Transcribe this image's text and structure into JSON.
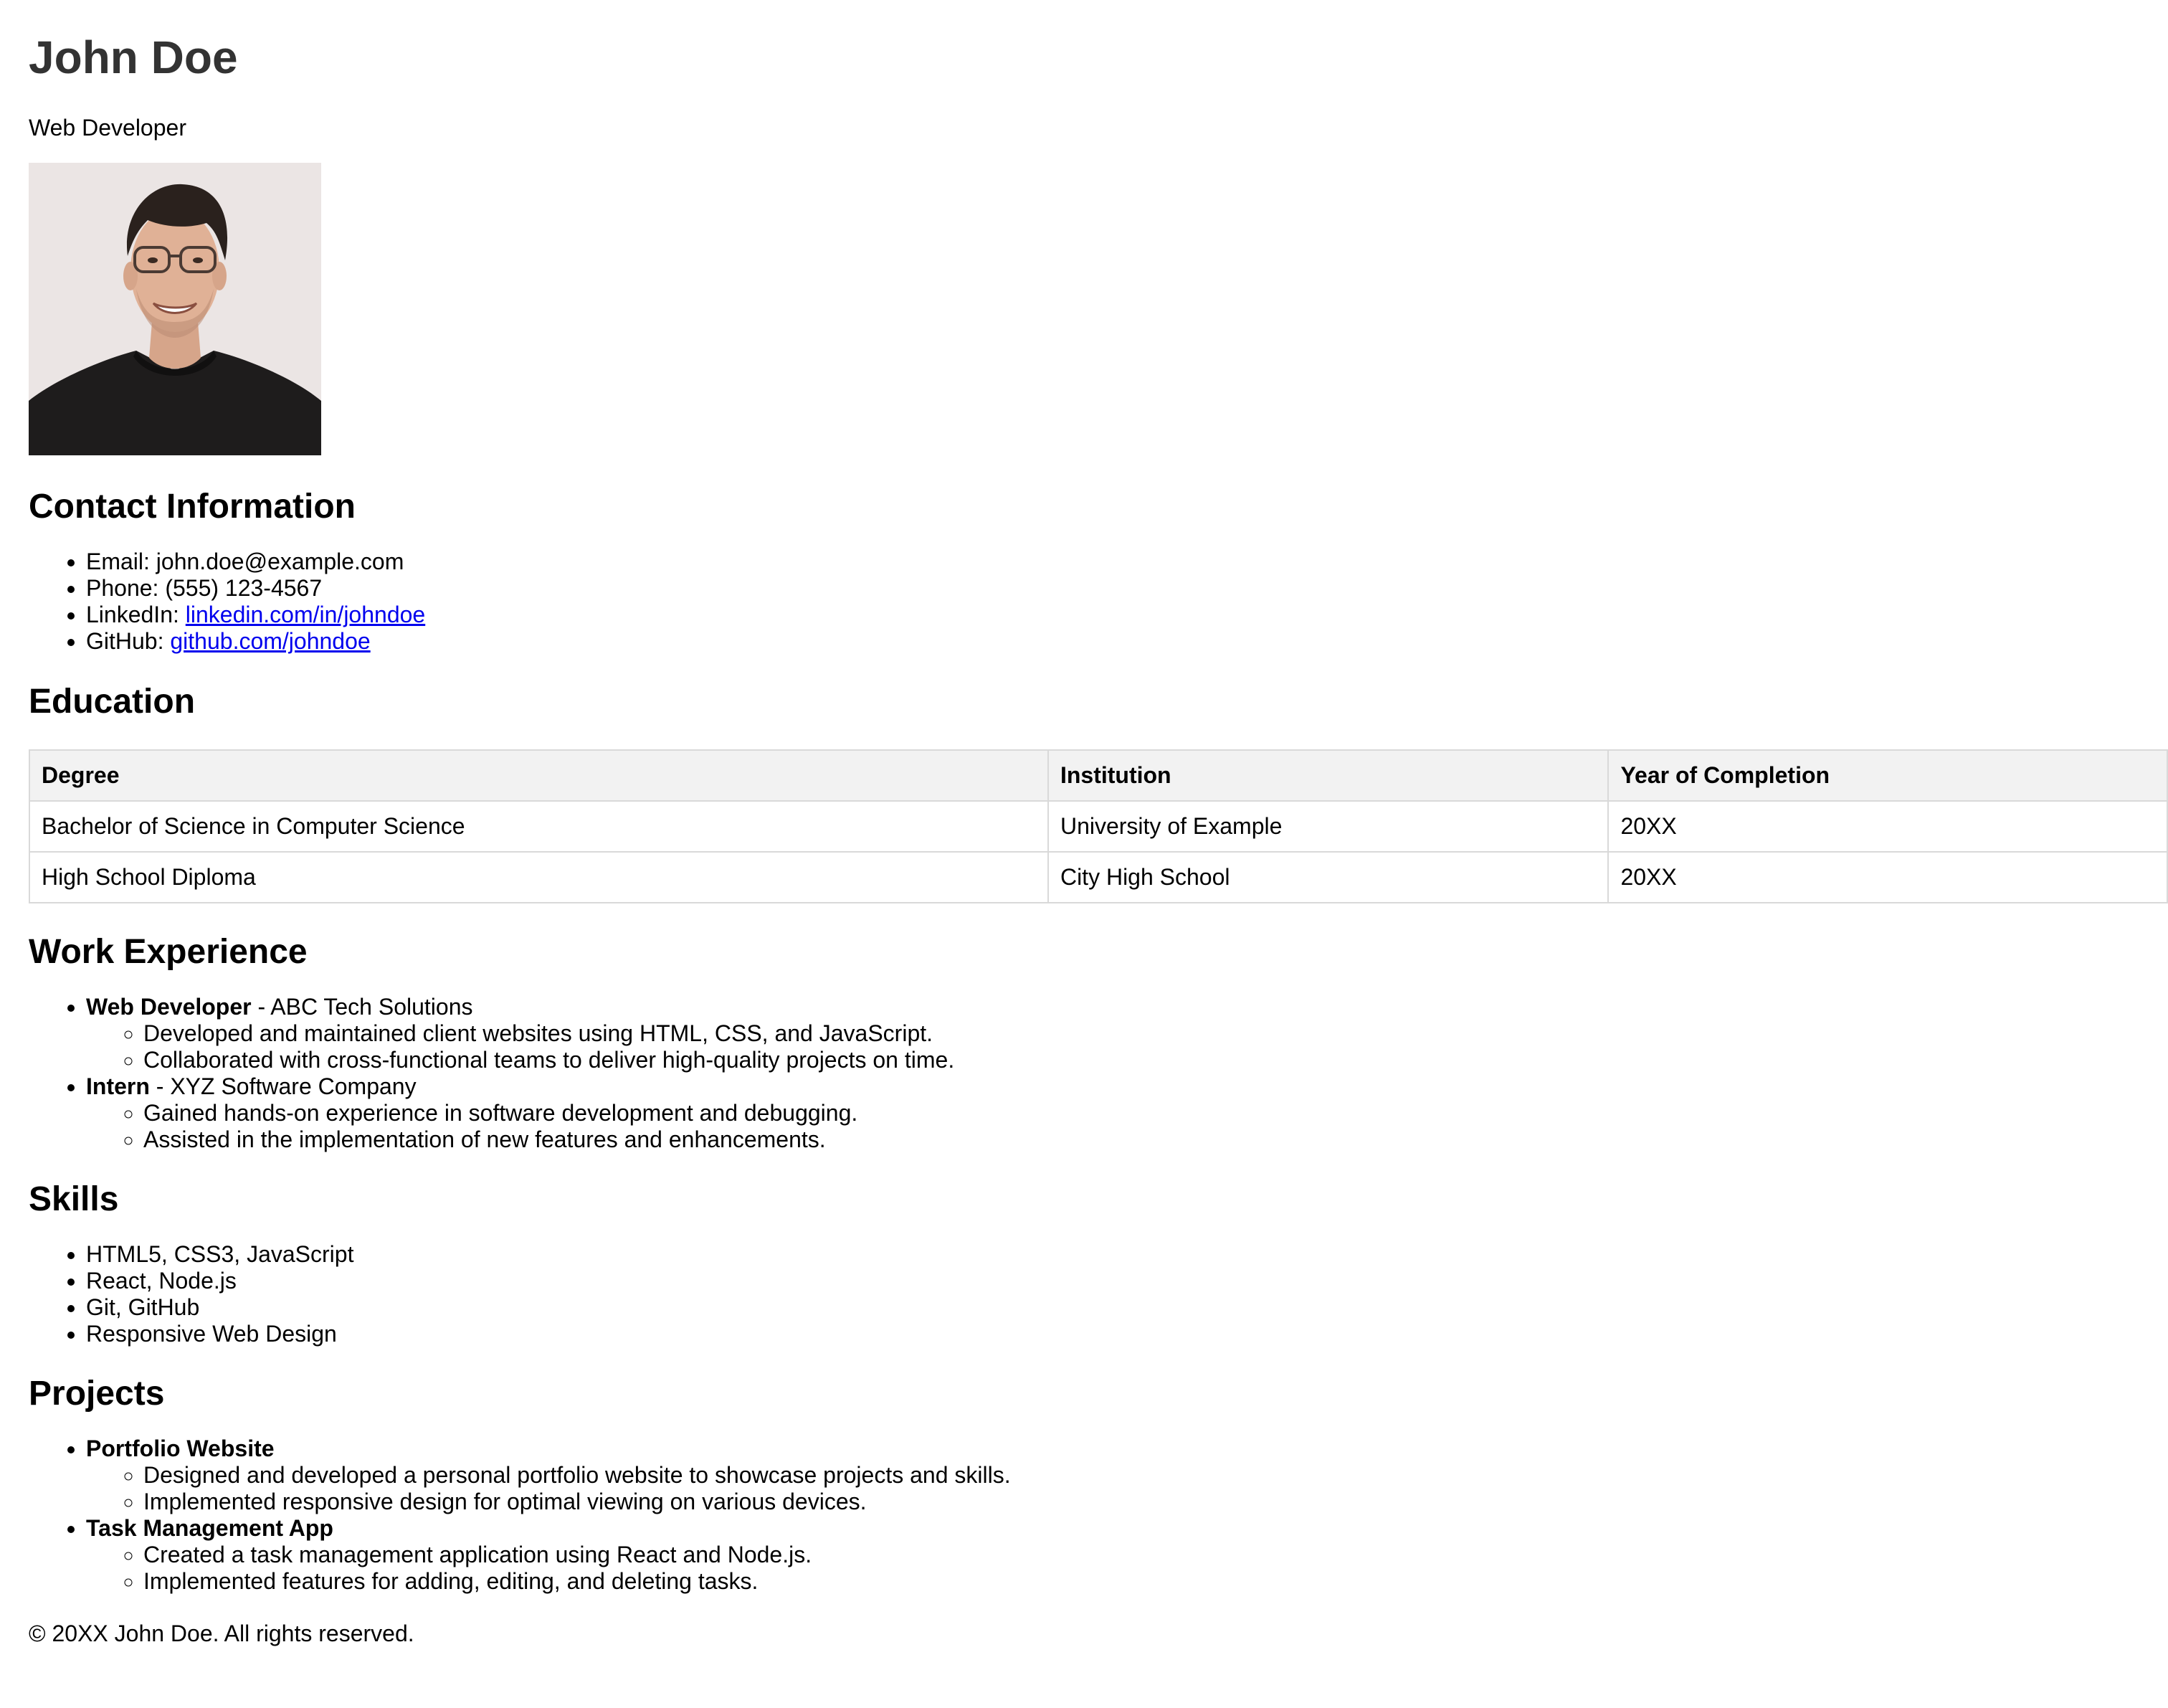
{
  "header": {
    "name": "John Doe",
    "title": "Web Developer",
    "photo_alt": "Profile photo of John Doe"
  },
  "contact": {
    "heading": "Contact Information",
    "email_label": "Email: ",
    "email": "john.doe@example.com",
    "phone_label": "Phone: ",
    "phone": "(555) 123-4567",
    "linkedin_label": "LinkedIn: ",
    "linkedin": "linkedin.com/in/johndoe",
    "github_label": "GitHub: ",
    "github": "github.com/johndoe"
  },
  "education": {
    "heading": "Education",
    "columns": [
      "Degree",
      "Institution",
      "Year of Completion"
    ],
    "rows": [
      [
        "Bachelor of Science in Computer Science",
        "University of Example",
        "20XX"
      ],
      [
        "High School Diploma",
        "City High School",
        "20XX"
      ]
    ]
  },
  "work": {
    "heading": "Work Experience",
    "jobs": [
      {
        "role": "Web Developer",
        "company": " - ABC Tech Solutions",
        "details": [
          "Developed and maintained client websites using HTML, CSS, and JavaScript.",
          "Collaborated with cross-functional teams to deliver high-quality projects on time."
        ]
      },
      {
        "role": "Intern",
        "company": " - XYZ Software Company",
        "details": [
          "Gained hands-on experience in software development and debugging.",
          "Assisted in the implementation of new features and enhancements."
        ]
      }
    ]
  },
  "skills": {
    "heading": "Skills",
    "items": [
      "HTML5, CSS3, JavaScript",
      "React, Node.js",
      "Git, GitHub",
      "Responsive Web Design"
    ]
  },
  "projects": {
    "heading": "Projects",
    "items": [
      {
        "name": "Portfolio Website",
        "details": [
          "Designed and developed a personal portfolio website to showcase projects and skills.",
          "Implemented responsive design for optimal viewing on various devices."
        ]
      },
      {
        "name": "Task Management App",
        "details": [
          "Created a task management application using React and Node.js.",
          "Implemented features for adding, editing, and deleting tasks."
        ]
      }
    ]
  },
  "footer": {
    "text": "© 20XX John Doe. All rights reserved."
  },
  "colors": {
    "name_heading": "#333333",
    "link": "#0000ee",
    "table_header_bg": "#f2f2f2",
    "table_border": "#d9d9d9",
    "photo_bg": "#e9e3e2"
  }
}
